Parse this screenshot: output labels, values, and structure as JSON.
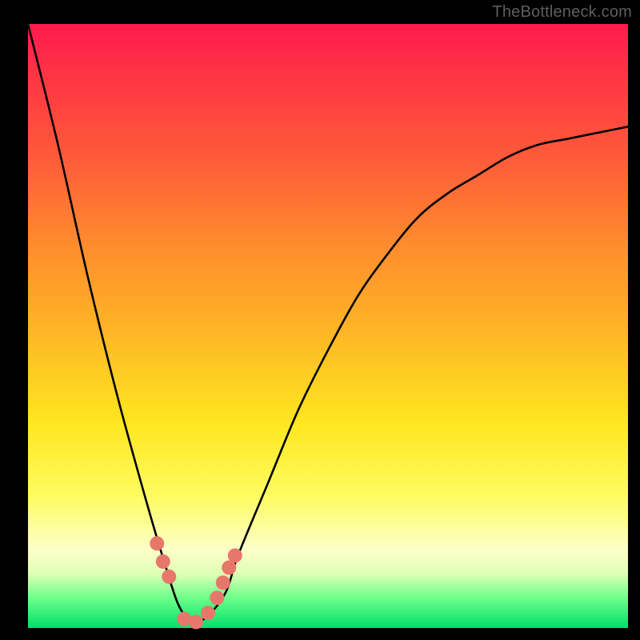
{
  "watermark": "TheBottleneck.com",
  "chart_data": {
    "type": "line",
    "title": "",
    "xlabel": "",
    "ylabel": "",
    "xlim": [
      0,
      100
    ],
    "ylim": [
      0,
      100
    ],
    "grid": false,
    "legend_position": "none",
    "series": [
      {
        "name": "bottleneck-curve",
        "x": [
          0,
          5,
          10,
          15,
          20,
          23,
          25,
          27,
          28,
          30,
          33,
          35,
          40,
          45,
          50,
          55,
          60,
          65,
          70,
          75,
          80,
          85,
          90,
          95,
          100
        ],
        "values": [
          100,
          80,
          58,
          38,
          20,
          10,
          4,
          1,
          1,
          2,
          6,
          12,
          24,
          36,
          46,
          55,
          62,
          68,
          72,
          75,
          78,
          80,
          81,
          82,
          83
        ]
      }
    ],
    "markers": {
      "name": "highlighted-points",
      "x": [
        21.5,
        22.5,
        23.5,
        26.0,
        28.0,
        30.0,
        31.5,
        32.5,
        33.5,
        34.5
      ],
      "values": [
        14.0,
        11.0,
        8.5,
        1.5,
        1.0,
        2.5,
        5.0,
        7.5,
        10.0,
        12.0
      ]
    },
    "background_gradient": {
      "direction": "vertical",
      "stops": [
        {
          "pos": 0.0,
          "color": "#ff1a4d"
        },
        {
          "pos": 0.22,
          "color": "#ff5a3a"
        },
        {
          "pos": 0.5,
          "color": "#ffb326"
        },
        {
          "pos": 0.78,
          "color": "#fffc60"
        },
        {
          "pos": 0.91,
          "color": "#e0ffb5"
        },
        {
          "pos": 1.0,
          "color": "#00e06a"
        }
      ]
    }
  }
}
